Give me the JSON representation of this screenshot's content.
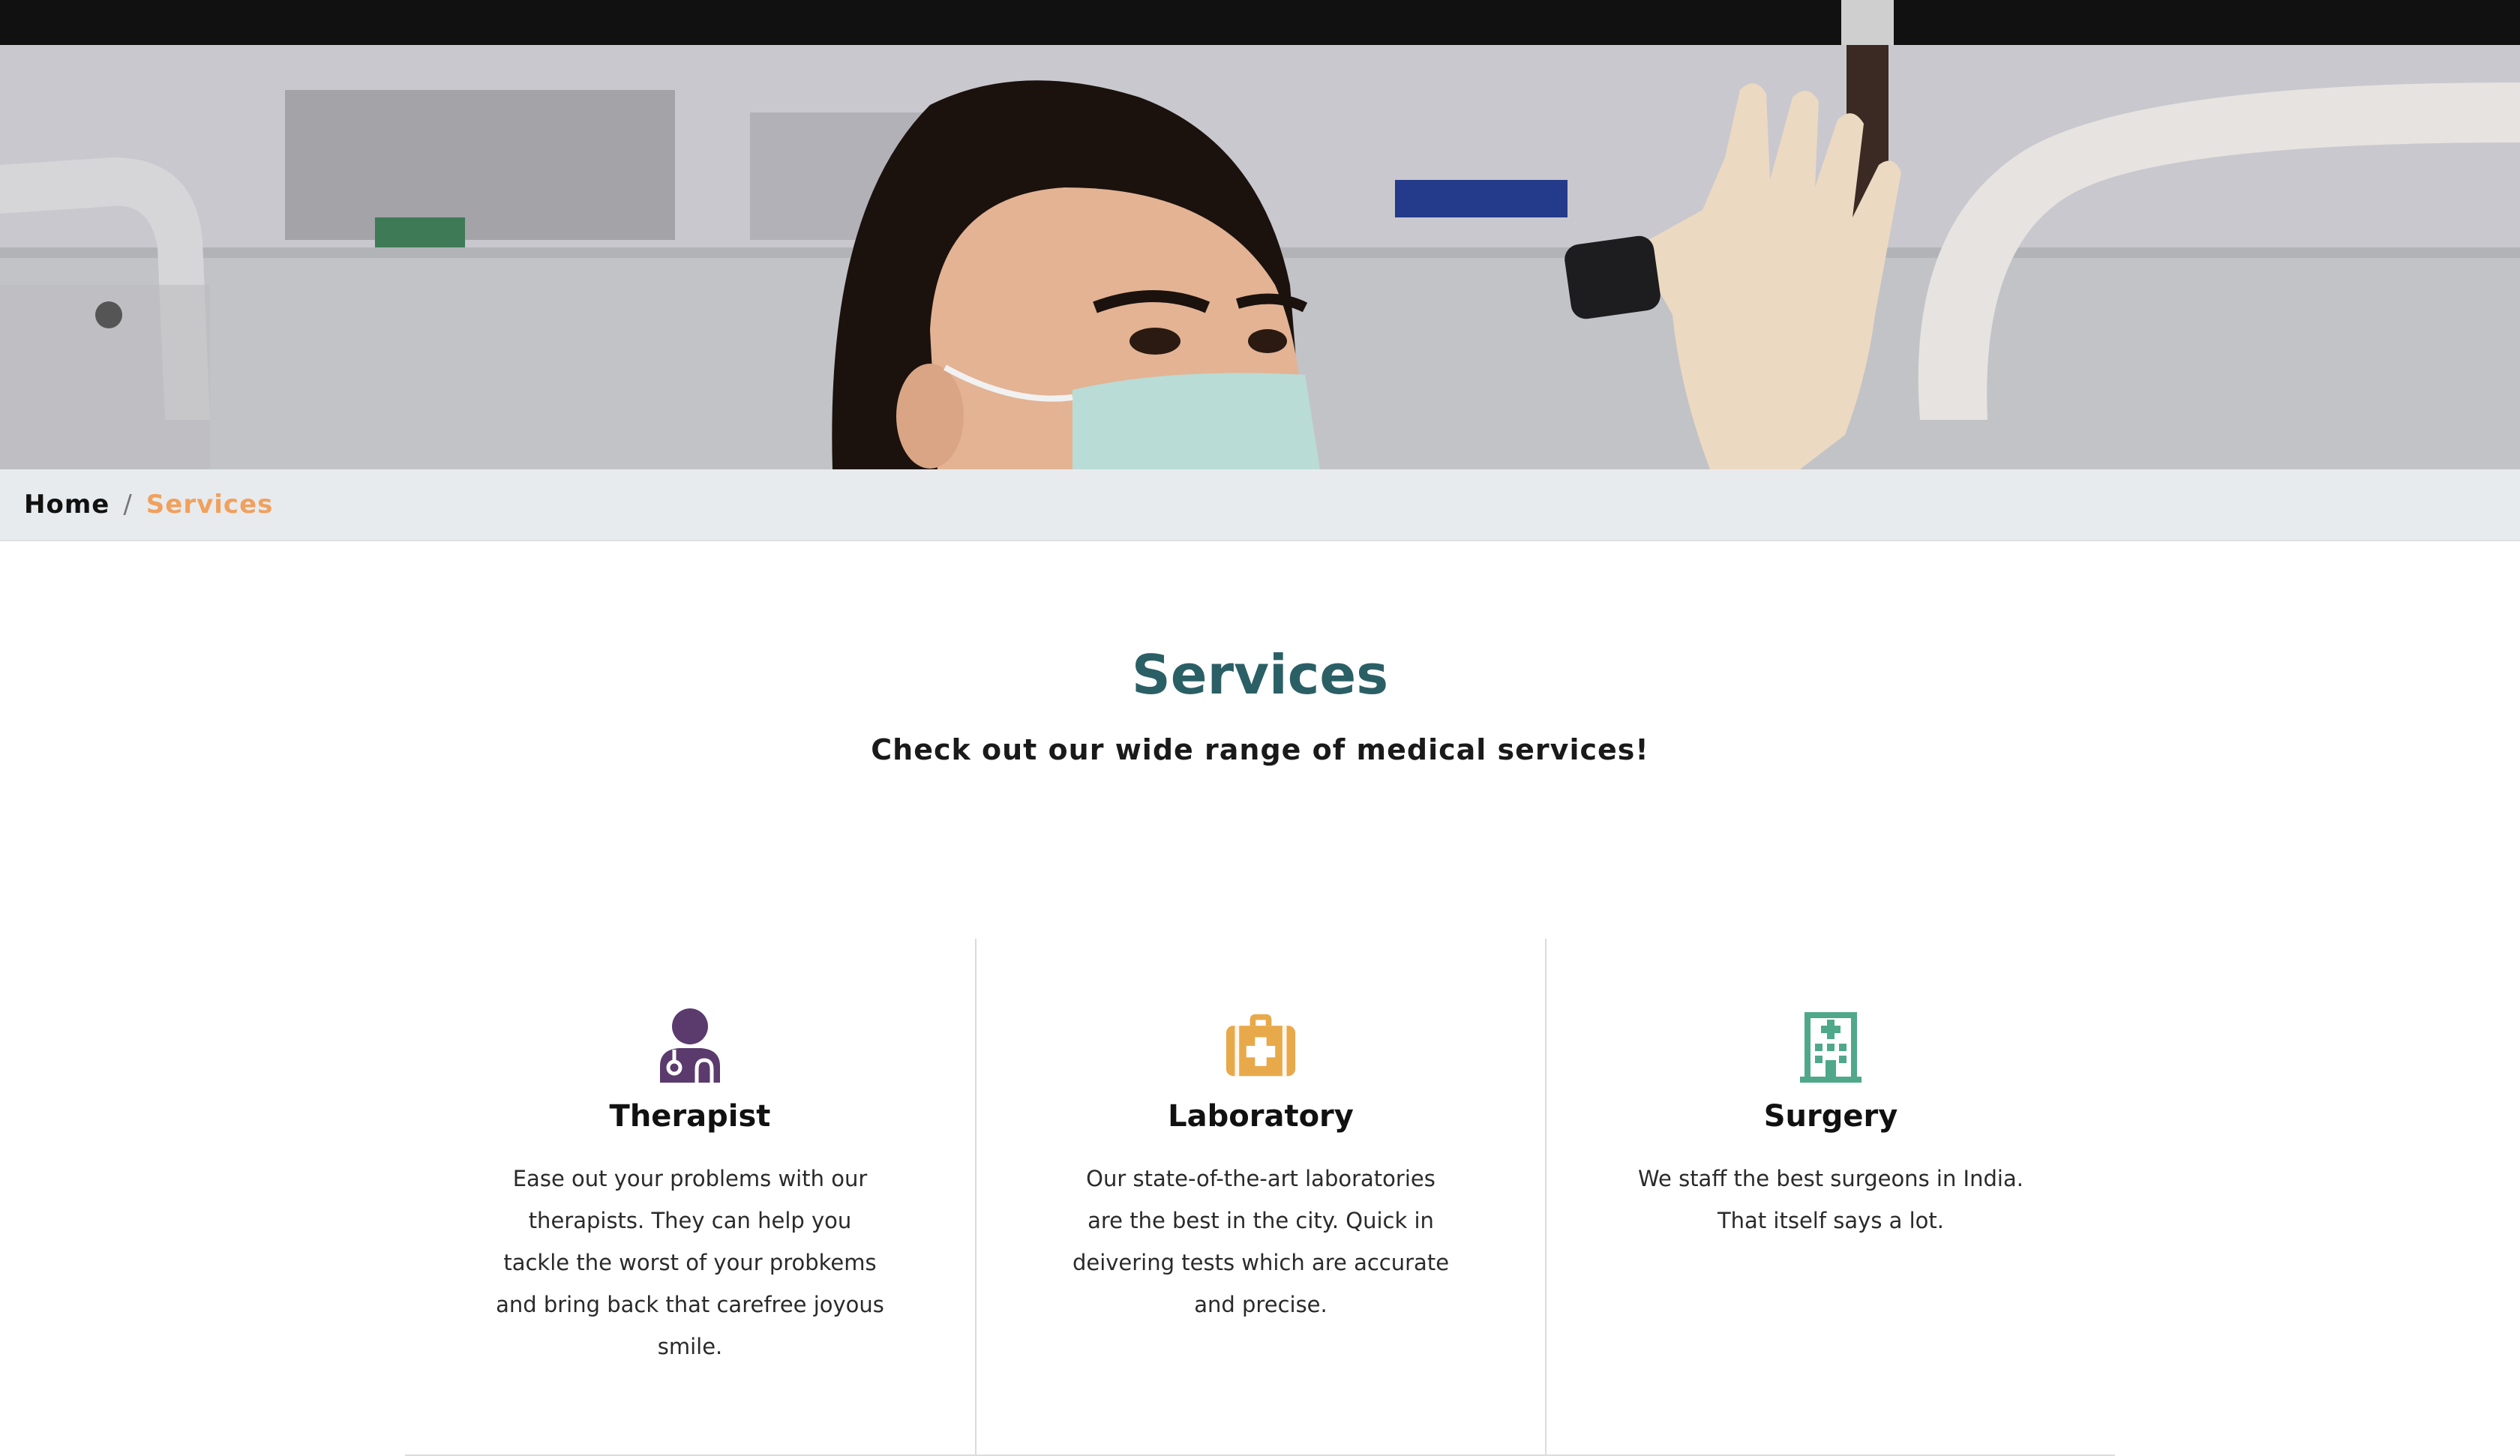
{
  "breadcrumb": {
    "home_label": "Home",
    "separator": "/",
    "current_label": "Services"
  },
  "hero": {
    "image_description_icon": "dental-hero-image"
  },
  "header": {
    "title": "Services",
    "subtitle": "Check out our wide range of medical services!"
  },
  "services": [
    {
      "icon": "doctor-icon",
      "icon_color": "#5b3a6e",
      "name": "Therapist",
      "description": "Ease out your problems with our therapists. They can help you tackle the worst of your probkems and bring back that carefree joyous smile."
    },
    {
      "icon": "medical-kit-icon",
      "icon_color": "#e8a94a",
      "name": "Laboratory",
      "description": "Our state-of-the-art laboratories are the best in the city. Quick in deivering tests which are accurate and precise."
    },
    {
      "icon": "hospital-icon",
      "icon_color": "#4fa88a",
      "name": "Surgery",
      "description": "We staff the best surgeons in India. That itself says a lot."
    }
  ],
  "colors": {
    "title": "#2b5f66",
    "breadcrumb_active": "#f0a15e",
    "breadcrumb_bg": "#e8ebee"
  }
}
